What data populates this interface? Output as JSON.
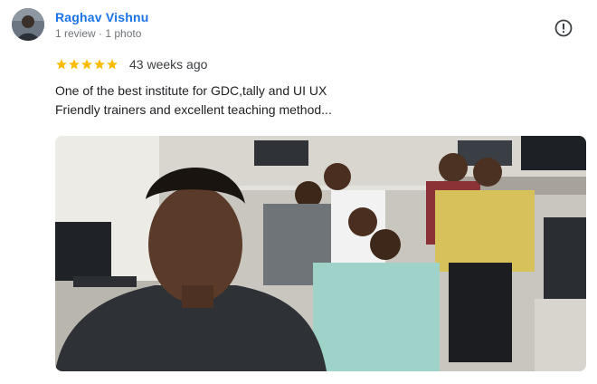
{
  "reviewer": {
    "name": "Raghav Vishnu",
    "meta": "1 review · 1 photo"
  },
  "rating": {
    "stars": 5,
    "max": 5,
    "time_ago": "43 weeks ago"
  },
  "review": {
    "lines": [
      "One of the best institute for GDC,tally and UI UX",
      "Friendly trainers and excellent teaching method..."
    ]
  },
  "icons": {
    "more": "more-info-icon",
    "star": "star-icon"
  },
  "colors": {
    "name": "#1a73e8",
    "star": "#fbbc04",
    "meta": "#70757a"
  }
}
